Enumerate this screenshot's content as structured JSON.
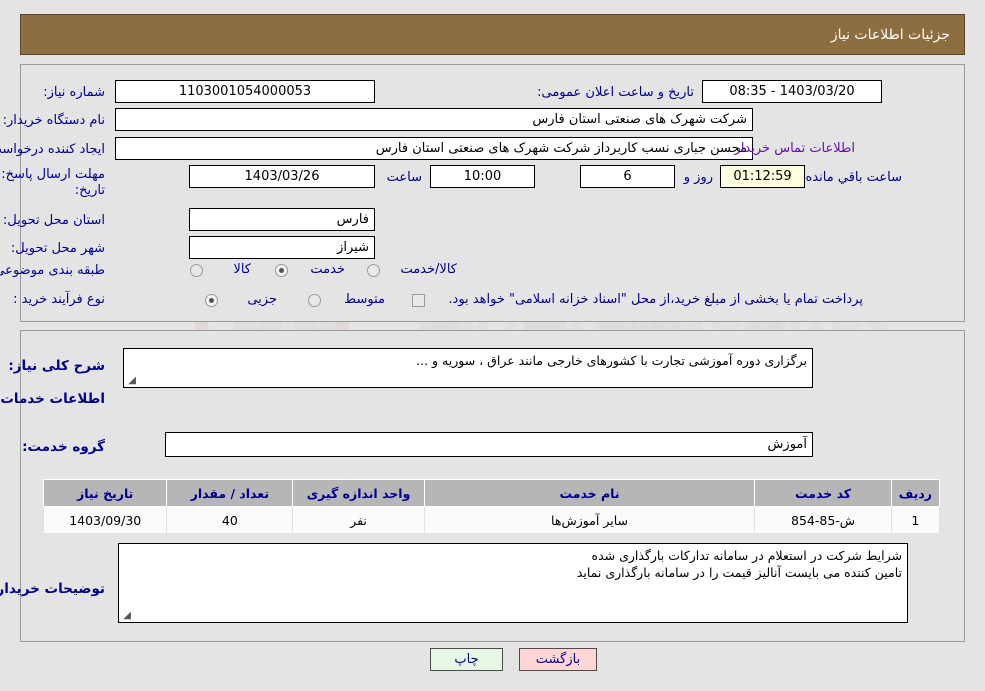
{
  "header": {
    "title": "جزئیات اطلاعات نیاز",
    "bar_color": "#8d6e41",
    "text_color": "#ffffff"
  },
  "top_panel": {
    "need_number": {
      "label": "شماره نیاز:",
      "value": "1103001054000053"
    },
    "announce_datetime": {
      "label": "تاریخ و ساعت اعلان عمومی:",
      "value": "1403/03/20 - 08:35"
    },
    "buyer_org": {
      "label": "نام دستگاه خریدار:",
      "value": "شرکت شهرک های صنعتی استان فارس"
    },
    "request_creator": {
      "label": "ایجاد کننده درخواست:",
      "value": "محسن  جباری نسب کاربرداز شرکت شهرک های صنعتی استان فارس"
    },
    "buyer_contact_link": "اطلاعات تماس خریدار",
    "deadline": {
      "label_line1": "مهلت ارسال پاسخ: تا",
      "label_line2": "تاریخ:",
      "date_value": "1403/03/26",
      "time_label": "ساعت",
      "time_value": "10:00",
      "days_value": "6",
      "days_label": "روز و",
      "countdown_value": "01:12:59",
      "countdown_label": "ساعت باقي مانده"
    },
    "delivery_province": {
      "label": "استان محل تحویل:",
      "value": "فارس"
    },
    "delivery_city": {
      "label": "شهر محل تحویل:",
      "value": "شیراز"
    },
    "subject_category": {
      "label": "طبقه بندی موضوعی:",
      "options": [
        {
          "label": "کالا",
          "selected": false
        },
        {
          "label": "خدمت",
          "selected": true
        },
        {
          "label": "کالا/خدمت",
          "selected": false
        }
      ]
    },
    "purchase_type": {
      "label": "نوع فرآیند خرید :",
      "options": [
        {
          "label": "جزیی",
          "selected": true
        },
        {
          "label": "متوسط",
          "selected": false
        }
      ],
      "islamic_treasury_checkbox": {
        "checked": false,
        "text": "پرداخت تمام یا بخشی از مبلغ خرید،از محل \"اسناد خزانه اسلامی\" خواهد بود."
      }
    }
  },
  "bottom_panel": {
    "general_description": {
      "label": "شرح کلی نیاز:",
      "value": "برگزاری دوره آموزشی تجارت با کشورهای خارجی مانند عراق ، سوریه و ..."
    },
    "services_heading": "اطلاعات خدمات مورد نیاز",
    "service_group": {
      "label": "گروه خدمت:",
      "value": "آموزش"
    },
    "table": {
      "columns": [
        "ردیف",
        "کد خدمت",
        "نام خدمت",
        "واحد اندازه گیری",
        "تعداد / مقدار",
        "تاریخ نیاز"
      ],
      "rows": [
        {
          "row_no": "1",
          "service_code": "ش-85-854",
          "service_name": "سایر آموزش‌ها",
          "unit": "نفر",
          "quantity": "40",
          "need_date": "1403/09/30"
        }
      ]
    },
    "buyer_notes": {
      "label": "توضیحات خریدار:",
      "line1": "شرایط شرکت در استعلام در سامانه تدارکات بارگذاری شده",
      "line2": "تامین کننده می بایست آنالیز قیمت را در سامانه بارگذاری نماید"
    }
  },
  "footer": {
    "back_button": "بازگشت",
    "print_button": "چاپ"
  },
  "watermark": {
    "text": "AriaTender.net"
  }
}
